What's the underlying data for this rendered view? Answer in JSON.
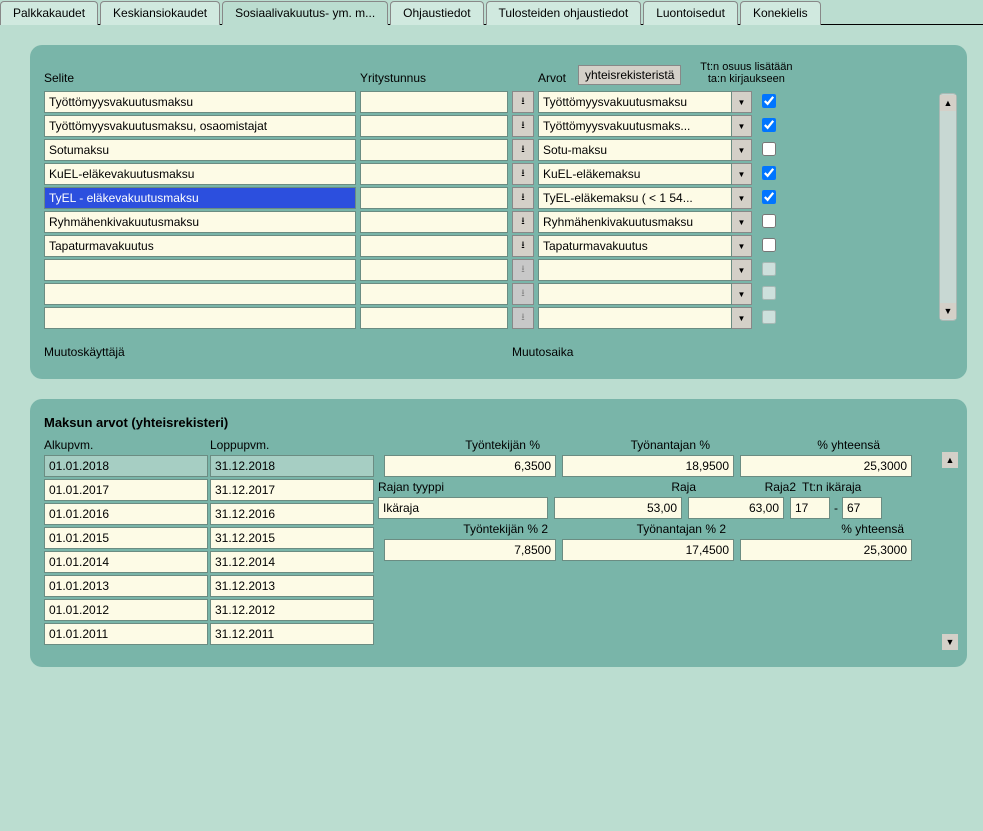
{
  "tabs": [
    {
      "label": "Palkkakaudet"
    },
    {
      "label": "Keskiansiokaudet"
    },
    {
      "label": "Sosiaalivakuutus- ym. m...",
      "active": true
    },
    {
      "label": "Ohjaustiedot"
    },
    {
      "label": "Tulosteiden ohjaustiedot"
    },
    {
      "label": "Luontoisedut"
    },
    {
      "label": "Konekielis"
    }
  ],
  "upper": {
    "headers": {
      "selite": "Selite",
      "yritystunnus": "Yritystunnus",
      "arvot": "Arvot",
      "yhteisrekisterista": "yhteisrekisteristä",
      "tt_osuus": "Tt:n osuus lisätään ta:n kirjaukseen"
    },
    "rows": [
      {
        "selite": "Työttömyysvakuutusmaksu",
        "yritystunnus": "",
        "arvo": "Työttömyysvakuutusmaksu",
        "chk": true,
        "enabled": true,
        "selected": false
      },
      {
        "selite": "Työttömyysvakuutusmaksu, osaomistajat",
        "yritystunnus": "",
        "arvo": "Työttömyysvakuutusmaks...",
        "chk": true,
        "enabled": true,
        "selected": false
      },
      {
        "selite": "Sotumaksu",
        "yritystunnus": "",
        "arvo": "Sotu-maksu",
        "chk": false,
        "enabled": true,
        "selected": false
      },
      {
        "selite": "KuEL-eläkevakuutusmaksu",
        "yritystunnus": "",
        "arvo": "KuEL-eläkemaksu",
        "chk": true,
        "enabled": true,
        "selected": false
      },
      {
        "selite": "TyEL - eläkevakuutusmaksu",
        "yritystunnus": "",
        "arvo": "TyEL-eläkemaksu ( < 1 54...",
        "chk": true,
        "enabled": true,
        "selected": true
      },
      {
        "selite": "Ryhmähenkivakuutusmaksu",
        "yritystunnus": "",
        "arvo": "Ryhmähenkivakuutusmaksu",
        "chk": false,
        "enabled": true,
        "selected": false
      },
      {
        "selite": "Tapaturmavakuutus",
        "yritystunnus": "",
        "arvo": "Tapaturmavakuutus",
        "chk": false,
        "enabled": true,
        "selected": false
      },
      {
        "selite": "",
        "yritystunnus": "",
        "arvo": "",
        "chk": false,
        "enabled": false,
        "selected": false
      },
      {
        "selite": "",
        "yritystunnus": "",
        "arvo": "",
        "chk": false,
        "enabled": false,
        "selected": false
      },
      {
        "selite": "",
        "yritystunnus": "",
        "arvo": "",
        "chk": false,
        "enabled": false,
        "selected": false
      }
    ],
    "footer": {
      "muutoskayttaja": "Muutoskäyttäjä",
      "muutosaika": "Muutosaika"
    }
  },
  "lower": {
    "title": "Maksun arvot (yhteisrekisteri)",
    "headers": {
      "alkupvm": "Alkupvm.",
      "loppupvm": "Loppupvm.",
      "tyontekijan_pct": "Työntekijän %",
      "tyonantajan_pct": "Työnantajan %",
      "yhteensa_pct": "% yhteensä",
      "rajan_tyyppi": "Rajan tyyppi",
      "raja": "Raja",
      "raja2": "Raja2",
      "tt_ikaraja": "Tt:n ikäraja",
      "tyontekijan_pct2": "Työntekijän % 2",
      "tyonantajan_pct2": "Työnantajan % 2",
      "yhteensa_pct2": "% yhteensä"
    },
    "dates": [
      {
        "alku": "01.01.2018",
        "loppu": "31.12.2018",
        "selected": true
      },
      {
        "alku": "01.01.2017",
        "loppu": "31.12.2017"
      },
      {
        "alku": "01.01.2016",
        "loppu": "31.12.2016"
      },
      {
        "alku": "01.01.2015",
        "loppu": "31.12.2015"
      },
      {
        "alku": "01.01.2014",
        "loppu": "31.12.2014"
      },
      {
        "alku": "01.01.2013",
        "loppu": "31.12.2013"
      },
      {
        "alku": "01.01.2012",
        "loppu": "31.12.2012"
      },
      {
        "alku": "01.01.2011",
        "loppu": "31.12.2011"
      }
    ],
    "values": {
      "tyontekijan": "6,3500",
      "tyonantajan": "18,9500",
      "yhteensa": "25,3000",
      "rajan_tyyppi": "Ikäraja",
      "raja": "53,00",
      "raja2": "63,00",
      "tt_ikaraja_from": "17",
      "tt_ikaraja_to": "67",
      "dash": "-",
      "tyontekijan2": "7,8500",
      "tyonantajan2": "17,4500",
      "yhteensa2": "25,3000"
    }
  }
}
